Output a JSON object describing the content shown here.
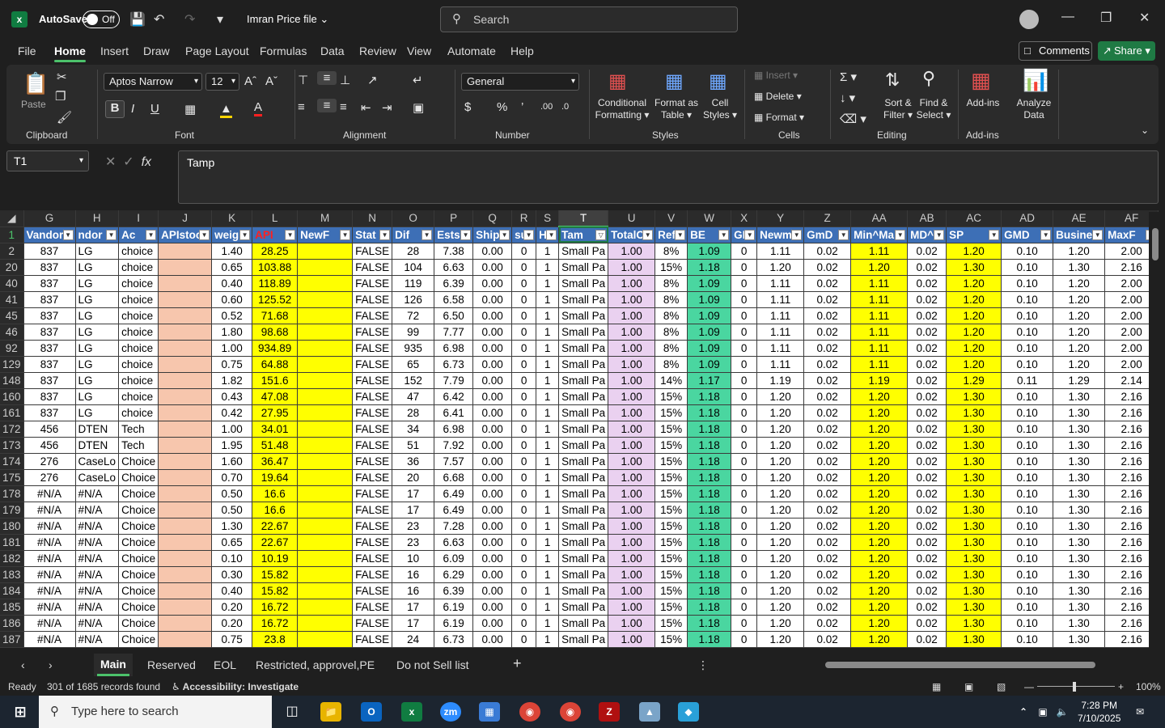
{
  "titlebar": {
    "autosave_label": "AutoSave",
    "autosave_state": "Off",
    "file_name": "Imran Price file",
    "search_placeholder": "Search"
  },
  "menu": [
    "File",
    "Home",
    "Insert",
    "Draw",
    "Page Layout",
    "Formulas",
    "Data",
    "Review",
    "View",
    "Automate",
    "Help"
  ],
  "menu_active": "Home",
  "comments_label": "Comments",
  "share_label": "Share",
  "ribbon": {
    "clipboard": {
      "label": "Clipboard",
      "paste": "Paste"
    },
    "font": {
      "label": "Font",
      "name": "Aptos Narrow",
      "size": "12"
    },
    "alignment": {
      "label": "Alignment"
    },
    "number": {
      "label": "Number",
      "format": "General"
    },
    "styles": {
      "label": "Styles",
      "conditional": "Conditional",
      "conditional2": "Formatting",
      "format_table": "Format as",
      "format_table2": "Table",
      "cell_styles": "Cell",
      "cell_styles2": "Styles"
    },
    "cells": {
      "label": "Cells",
      "insert": "Insert",
      "delete": "Delete",
      "format": "Format"
    },
    "editing": {
      "label": "Editing",
      "sort": "Sort &",
      "sort2": "Filter",
      "find": "Find &",
      "find2": "Select"
    },
    "addins": {
      "label": "Add-ins",
      "addins": "Add-ins",
      "analyze": "Analyze",
      "analyze2": "Data"
    }
  },
  "formula_bar": {
    "name_box": "T1",
    "content": "Tamp"
  },
  "columns": [
    "G",
    "H",
    "I",
    "J",
    "K",
    "L",
    "M",
    "N",
    "O",
    "P",
    "Q",
    "R",
    "S",
    "T",
    "U",
    "V",
    "W",
    "X",
    "Y",
    "Z",
    "AA",
    "AB",
    "AC",
    "AD",
    "AE",
    "AF"
  ],
  "header_row": {
    "row_num": "1",
    "cells": [
      "Vandor",
      "ndor",
      "Ac",
      "APIstoc",
      "weig",
      "API",
      "NewF",
      "Stat",
      "Dif",
      "Ests",
      "Ship",
      "sui",
      "H",
      "Tam",
      "TotalC",
      "Ref",
      "BE",
      "GI",
      "Newm",
      "GmD",
      "Min^Ma",
      "MD^",
      "SP",
      "GMD",
      "Busines",
      "MaxF"
    ]
  },
  "rows": [
    {
      "n": "2",
      "c": [
        "837",
        "LG",
        "choice",
        "",
        "1.40",
        "28.25",
        "",
        "FALSE",
        "28",
        "7.38",
        "0.00",
        "0",
        "1",
        "Small Pa",
        "1.00",
        "8%",
        "1.09",
        "0",
        "1.11",
        "0.02",
        "1.11",
        "0.02",
        "1.20",
        "0.10",
        "1.20",
        "2.00"
      ]
    },
    {
      "n": "20",
      "c": [
        "837",
        "LG",
        "choice",
        "",
        "0.65",
        "103.88",
        "",
        "FALSE",
        "104",
        "6.63",
        "0.00",
        "0",
        "1",
        "Small Pa",
        "1.00",
        "15%",
        "1.18",
        "0",
        "1.20",
        "0.02",
        "1.20",
        "0.02",
        "1.30",
        "0.10",
        "1.30",
        "2.16"
      ]
    },
    {
      "n": "40",
      "c": [
        "837",
        "LG",
        "choice",
        "",
        "0.40",
        "118.89",
        "",
        "FALSE",
        "119",
        "6.39",
        "0.00",
        "0",
        "1",
        "Small Pa",
        "1.00",
        "8%",
        "1.09",
        "0",
        "1.11",
        "0.02",
        "1.11",
        "0.02",
        "1.20",
        "0.10",
        "1.20",
        "2.00"
      ]
    },
    {
      "n": "41",
      "c": [
        "837",
        "LG",
        "choice",
        "",
        "0.60",
        "125.52",
        "",
        "FALSE",
        "126",
        "6.58",
        "0.00",
        "0",
        "1",
        "Small Pa",
        "1.00",
        "8%",
        "1.09",
        "0",
        "1.11",
        "0.02",
        "1.11",
        "0.02",
        "1.20",
        "0.10",
        "1.20",
        "2.00"
      ]
    },
    {
      "n": "45",
      "c": [
        "837",
        "LG",
        "choice",
        "",
        "0.52",
        "71.68",
        "",
        "FALSE",
        "72",
        "6.50",
        "0.00",
        "0",
        "1",
        "Small Pa",
        "1.00",
        "8%",
        "1.09",
        "0",
        "1.11",
        "0.02",
        "1.11",
        "0.02",
        "1.20",
        "0.10",
        "1.20",
        "2.00"
      ]
    },
    {
      "n": "46",
      "c": [
        "837",
        "LG",
        "choice",
        "",
        "1.80",
        "98.68",
        "",
        "FALSE",
        "99",
        "7.77",
        "0.00",
        "0",
        "1",
        "Small Pa",
        "1.00",
        "8%",
        "1.09",
        "0",
        "1.11",
        "0.02",
        "1.11",
        "0.02",
        "1.20",
        "0.10",
        "1.20",
        "2.00"
      ]
    },
    {
      "n": "92",
      "c": [
        "837",
        "LG",
        "choice",
        "",
        "1.00",
        "934.89",
        "",
        "FALSE",
        "935",
        "6.98",
        "0.00",
        "0",
        "1",
        "Small Pa",
        "1.00",
        "8%",
        "1.09",
        "0",
        "1.11",
        "0.02",
        "1.11",
        "0.02",
        "1.20",
        "0.10",
        "1.20",
        "2.00"
      ]
    },
    {
      "n": "129",
      "c": [
        "837",
        "LG",
        "choice",
        "",
        "0.75",
        "64.88",
        "",
        "FALSE",
        "65",
        "6.73",
        "0.00",
        "0",
        "1",
        "Small Pa",
        "1.00",
        "8%",
        "1.09",
        "0",
        "1.11",
        "0.02",
        "1.11",
        "0.02",
        "1.20",
        "0.10",
        "1.20",
        "2.00"
      ]
    },
    {
      "n": "148",
      "c": [
        "837",
        "LG",
        "choice",
        "",
        "1.82",
        "151.6",
        "",
        "FALSE",
        "152",
        "7.79",
        "0.00",
        "0",
        "1",
        "Small Pa",
        "1.00",
        "14%",
        "1.17",
        "0",
        "1.19",
        "0.02",
        "1.19",
        "0.02",
        "1.29",
        "0.11",
        "1.29",
        "2.14"
      ]
    },
    {
      "n": "160",
      "c": [
        "837",
        "LG",
        "choice",
        "",
        "0.43",
        "47.08",
        "",
        "FALSE",
        "47",
        "6.42",
        "0.00",
        "0",
        "1",
        "Small Pa",
        "1.00",
        "15%",
        "1.18",
        "0",
        "1.20",
        "0.02",
        "1.20",
        "0.02",
        "1.30",
        "0.10",
        "1.30",
        "2.16"
      ]
    },
    {
      "n": "161",
      "c": [
        "837",
        "LG",
        "choice",
        "",
        "0.42",
        "27.95",
        "",
        "FALSE",
        "28",
        "6.41",
        "0.00",
        "0",
        "1",
        "Small Pa",
        "1.00",
        "15%",
        "1.18",
        "0",
        "1.20",
        "0.02",
        "1.20",
        "0.02",
        "1.30",
        "0.10",
        "1.30",
        "2.16"
      ]
    },
    {
      "n": "172",
      "c": [
        "456",
        "DTEN",
        "Tech",
        "",
        "1.00",
        "34.01",
        "",
        "FALSE",
        "34",
        "6.98",
        "0.00",
        "0",
        "1",
        "Small Pa",
        "1.00",
        "15%",
        "1.18",
        "0",
        "1.20",
        "0.02",
        "1.20",
        "0.02",
        "1.30",
        "0.10",
        "1.30",
        "2.16"
      ]
    },
    {
      "n": "173",
      "c": [
        "456",
        "DTEN",
        "Tech",
        "",
        "1.95",
        "51.48",
        "",
        "FALSE",
        "51",
        "7.92",
        "0.00",
        "0",
        "1",
        "Small Pa",
        "1.00",
        "15%",
        "1.18",
        "0",
        "1.20",
        "0.02",
        "1.20",
        "0.02",
        "1.30",
        "0.10",
        "1.30",
        "2.16"
      ]
    },
    {
      "n": "174",
      "c": [
        "276",
        "CaseLo",
        "Choice",
        "",
        "1.60",
        "36.47",
        "",
        "FALSE",
        "36",
        "7.57",
        "0.00",
        "0",
        "1",
        "Small Pa",
        "1.00",
        "15%",
        "1.18",
        "0",
        "1.20",
        "0.02",
        "1.20",
        "0.02",
        "1.30",
        "0.10",
        "1.30",
        "2.16"
      ]
    },
    {
      "n": "175",
      "c": [
        "276",
        "CaseLo",
        "Choice",
        "",
        "0.70",
        "19.64",
        "",
        "FALSE",
        "20",
        "6.68",
        "0.00",
        "0",
        "1",
        "Small Pa",
        "1.00",
        "15%",
        "1.18",
        "0",
        "1.20",
        "0.02",
        "1.20",
        "0.02",
        "1.30",
        "0.10",
        "1.30",
        "2.16"
      ]
    },
    {
      "n": "178",
      "c": [
        "#N/A",
        "#N/A",
        "Choice",
        "",
        "0.50",
        "16.6",
        "",
        "FALSE",
        "17",
        "6.49",
        "0.00",
        "0",
        "1",
        "Small Pa",
        "1.00",
        "15%",
        "1.18",
        "0",
        "1.20",
        "0.02",
        "1.20",
        "0.02",
        "1.30",
        "0.10",
        "1.30",
        "2.16"
      ]
    },
    {
      "n": "179",
      "c": [
        "#N/A",
        "#N/A",
        "Choice",
        "",
        "0.50",
        "16.6",
        "",
        "FALSE",
        "17",
        "6.49",
        "0.00",
        "0",
        "1",
        "Small Pa",
        "1.00",
        "15%",
        "1.18",
        "0",
        "1.20",
        "0.02",
        "1.20",
        "0.02",
        "1.30",
        "0.10",
        "1.30",
        "2.16"
      ]
    },
    {
      "n": "180",
      "c": [
        "#N/A",
        "#N/A",
        "Choice",
        "",
        "1.30",
        "22.67",
        "",
        "FALSE",
        "23",
        "7.28",
        "0.00",
        "0",
        "1",
        "Small Pa",
        "1.00",
        "15%",
        "1.18",
        "0",
        "1.20",
        "0.02",
        "1.20",
        "0.02",
        "1.30",
        "0.10",
        "1.30",
        "2.16"
      ]
    },
    {
      "n": "181",
      "c": [
        "#N/A",
        "#N/A",
        "Choice",
        "",
        "0.65",
        "22.67",
        "",
        "FALSE",
        "23",
        "6.63",
        "0.00",
        "0",
        "1",
        "Small Pa",
        "1.00",
        "15%",
        "1.18",
        "0",
        "1.20",
        "0.02",
        "1.20",
        "0.02",
        "1.30",
        "0.10",
        "1.30",
        "2.16"
      ]
    },
    {
      "n": "182",
      "c": [
        "#N/A",
        "#N/A",
        "Choice",
        "",
        "0.10",
        "10.19",
        "",
        "FALSE",
        "10",
        "6.09",
        "0.00",
        "0",
        "1",
        "Small Pa",
        "1.00",
        "15%",
        "1.18",
        "0",
        "1.20",
        "0.02",
        "1.20",
        "0.02",
        "1.30",
        "0.10",
        "1.30",
        "2.16"
      ]
    },
    {
      "n": "183",
      "c": [
        "#N/A",
        "#N/A",
        "Choice",
        "",
        "0.30",
        "15.82",
        "",
        "FALSE",
        "16",
        "6.29",
        "0.00",
        "0",
        "1",
        "Small Pa",
        "1.00",
        "15%",
        "1.18",
        "0",
        "1.20",
        "0.02",
        "1.20",
        "0.02",
        "1.30",
        "0.10",
        "1.30",
        "2.16"
      ]
    },
    {
      "n": "184",
      "c": [
        "#N/A",
        "#N/A",
        "Choice",
        "",
        "0.40",
        "15.82",
        "",
        "FALSE",
        "16",
        "6.39",
        "0.00",
        "0",
        "1",
        "Small Pa",
        "1.00",
        "15%",
        "1.18",
        "0",
        "1.20",
        "0.02",
        "1.20",
        "0.02",
        "1.30",
        "0.10",
        "1.30",
        "2.16"
      ]
    },
    {
      "n": "185",
      "c": [
        "#N/A",
        "#N/A",
        "Choice",
        "",
        "0.20",
        "16.72",
        "",
        "FALSE",
        "17",
        "6.19",
        "0.00",
        "0",
        "1",
        "Small Pa",
        "1.00",
        "15%",
        "1.18",
        "0",
        "1.20",
        "0.02",
        "1.20",
        "0.02",
        "1.30",
        "0.10",
        "1.30",
        "2.16"
      ]
    },
    {
      "n": "186",
      "c": [
        "#N/A",
        "#N/A",
        "Choice",
        "",
        "0.20",
        "16.72",
        "",
        "FALSE",
        "17",
        "6.19",
        "0.00",
        "0",
        "1",
        "Small Pa",
        "1.00",
        "15%",
        "1.18",
        "0",
        "1.20",
        "0.02",
        "1.20",
        "0.02",
        "1.30",
        "0.10",
        "1.30",
        "2.16"
      ]
    },
    {
      "n": "187",
      "c": [
        "#N/A",
        "#N/A",
        "Choice",
        "",
        "0.75",
        "23.8",
        "",
        "FALSE",
        "24",
        "6.73",
        "0.00",
        "0",
        "1",
        "Small Pa",
        "1.00",
        "15%",
        "1.18",
        "0",
        "1.20",
        "0.02",
        "1.20",
        "0.02",
        "1.30",
        "0.10",
        "1.30",
        "2.16"
      ]
    }
  ],
  "sheet_tabs": [
    "Main",
    "Reserved",
    "EOL",
    "Restricted, approvel,PE",
    "Do not Sell list"
  ],
  "active_sheet": "Main",
  "status": {
    "ready": "Ready",
    "records": "301 of 1685 records found",
    "accessibility": "Accessibility: Investigate",
    "zoom": "100%"
  },
  "taskbar": {
    "search_placeholder": "Type here to search",
    "time": "7:28 PM",
    "date": "7/10/2025"
  },
  "colors": {
    "header_blue": "#3d6fb6",
    "yellow": "#ffff00",
    "salmon": "#f7c6ad",
    "pink": "#ead1f0",
    "green": "#4ad6a0",
    "accent": "#1f7a44"
  }
}
